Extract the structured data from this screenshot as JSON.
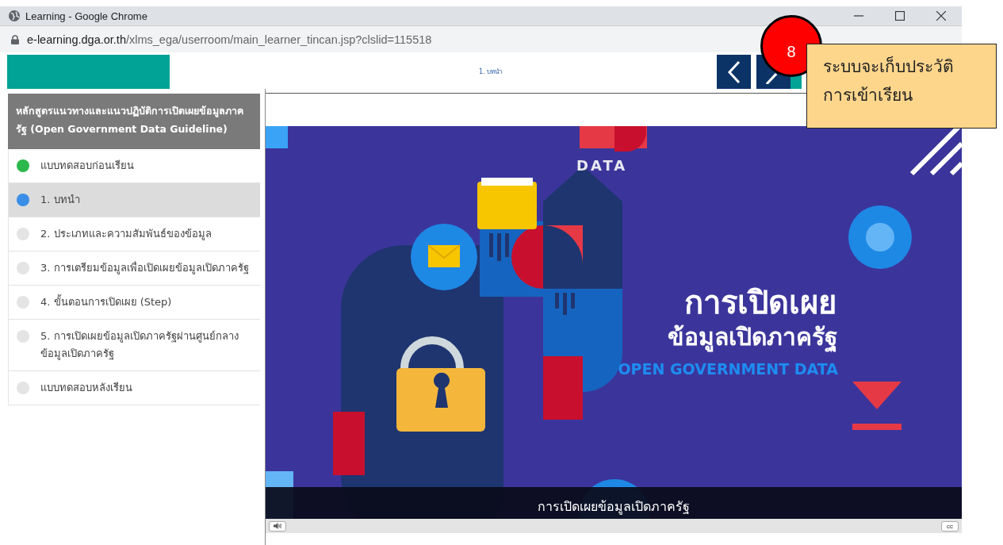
{
  "window": {
    "title": "Learning - Google Chrome"
  },
  "address_bar": {
    "domain": "e-learning.dga.or.th",
    "path": "/xlms_ega/userroom/main_learner_tincan.jsp?clslid=115518"
  },
  "header": {
    "lesson_title": "1. บทนำ"
  },
  "course": {
    "title": "หลักสูตรแนวทางและแนวปฏิบัติการเปิดเผยข้อมูลภาครัฐ (Open Government Data Guideline)",
    "lessons": [
      {
        "label": "แบบทดสอบก่อนเรียน",
        "selected": false,
        "color": "#2db84b"
      },
      {
        "label": "1. บทนำ",
        "selected": true,
        "color": "#3a8ee6"
      },
      {
        "label": "2. ประเภทและความสัมพันธ์ของข้อมูล",
        "selected": false,
        "color": "#e4e4e4"
      },
      {
        "label": "3. การเตรียมข้อมูลเพื่อเปิดเผยข้อมูลเปิดภาครัฐ",
        "selected": false,
        "color": "#e4e4e4"
      },
      {
        "label": "4. ขั้นตอนการเปิดเผย (Step)",
        "selected": false,
        "color": "#e4e4e4"
      },
      {
        "label": "5. การเปิดเผยข้อมูลเปิดภาครัฐผ่านศูนย์กลางข้อมูลเปิดภาครัฐ",
        "selected": false,
        "color": "#e4e4e4"
      },
      {
        "label": "แบบทดสอบหลังเรียน",
        "selected": false,
        "color": "#e4e4e4"
      }
    ]
  },
  "slide": {
    "brand": "DATA",
    "title_line_1": "การเปิดเผย",
    "title_line_2": "ข้อมูลเปิดภาครัฐ",
    "subtitle": "OPEN GOVERNMENT DATA"
  },
  "caption": "การเปิดเผยข้อมูลเปิดภาครัฐ",
  "player": {
    "cc_label": "cc"
  },
  "annotation": {
    "number": "8",
    "lines": [
      "ระบบจะเก็บประวัติ",
      "การเข้าเรียน"
    ]
  }
}
